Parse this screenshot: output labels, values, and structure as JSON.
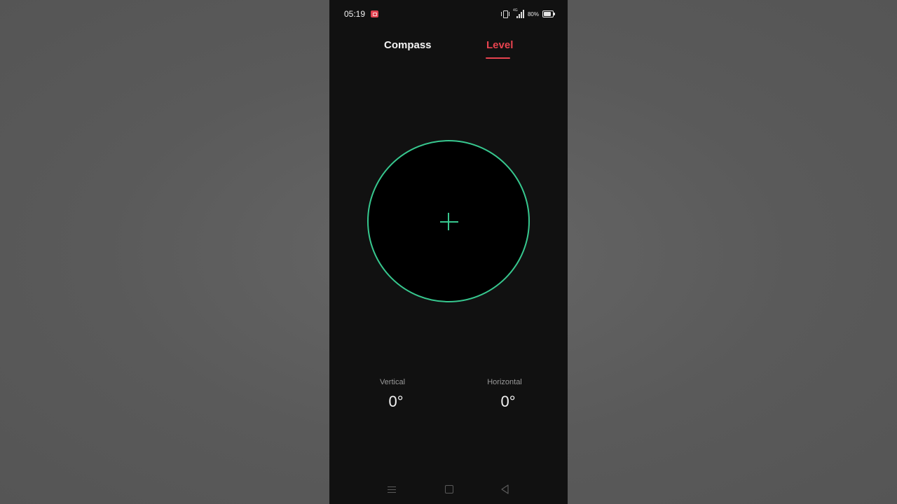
{
  "status_bar": {
    "time": "05:19",
    "signal_label": "4G",
    "battery_percent": "80%",
    "battery_level": 0.8
  },
  "tabs": [
    {
      "label": "Compass",
      "active": false
    },
    {
      "label": "Level",
      "active": true
    }
  ],
  "level": {
    "vertical": {
      "label": "Vertical",
      "value": "0°"
    },
    "horizontal": {
      "label": "Horizontal",
      "value": "0°"
    }
  },
  "colors": {
    "accent": "#e8434f",
    "level_ring": "#37c88f",
    "background": "#111111"
  },
  "icons": [
    "record-icon",
    "vibrate-icon",
    "signal-icon",
    "battery-icon",
    "menu-icon",
    "home-icon",
    "back-icon"
  ]
}
